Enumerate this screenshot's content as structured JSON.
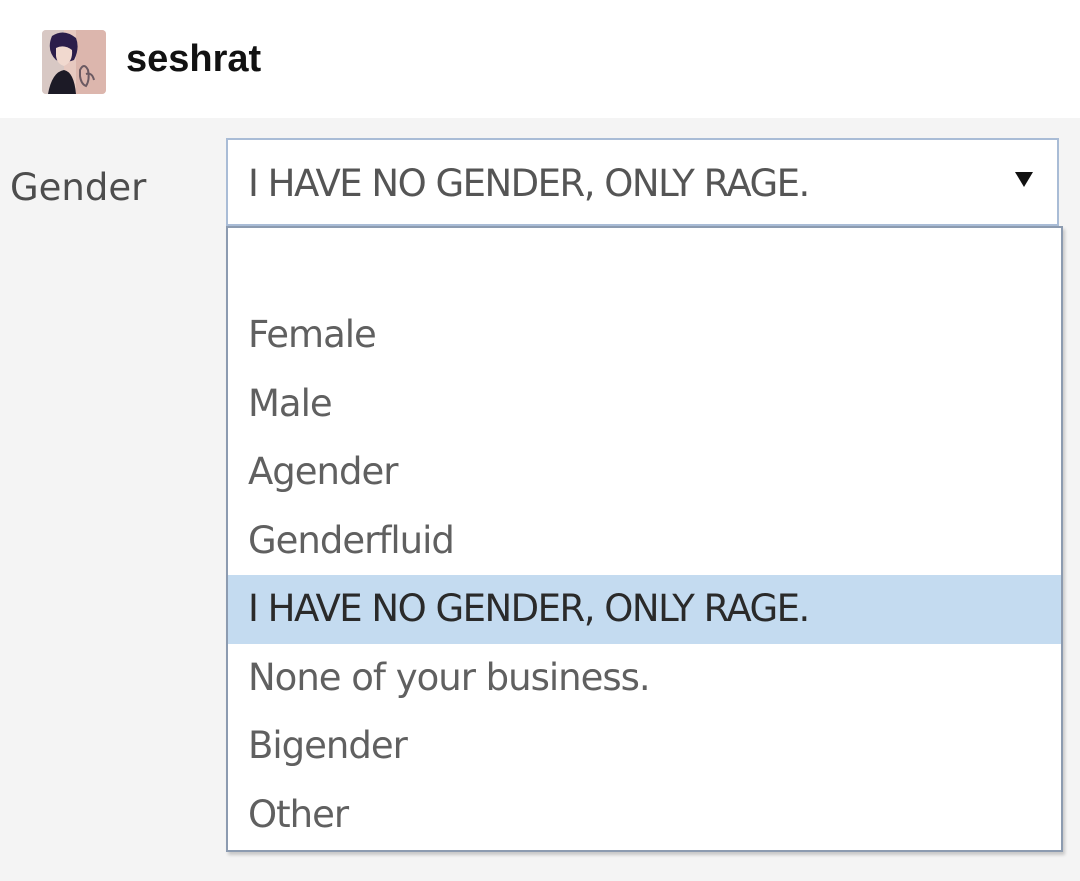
{
  "post": {
    "username": "seshrat",
    "avatar_icon": "anime-character-avatar-icon"
  },
  "form": {
    "field_label": "Gender",
    "select": {
      "selected_value": "I HAVE NO GENDER, ONLY RAGE.",
      "arrow_icon": "caret-down-icon",
      "options": [
        {
          "label": "Female",
          "selected": false
        },
        {
          "label": "Male",
          "selected": false
        },
        {
          "label": "Agender",
          "selected": false
        },
        {
          "label": "Genderfluid",
          "selected": false
        },
        {
          "label": "I HAVE NO GENDER, ONLY RAGE.",
          "selected": true
        },
        {
          "label": "None of your business.",
          "selected": false
        },
        {
          "label": "Bigender",
          "selected": false
        },
        {
          "label": "Other",
          "selected": false
        }
      ]
    }
  },
  "colors": {
    "highlight": "#c4dbf0",
    "select_border": "#a9bcd6",
    "form_background": "#f4f4f4"
  }
}
